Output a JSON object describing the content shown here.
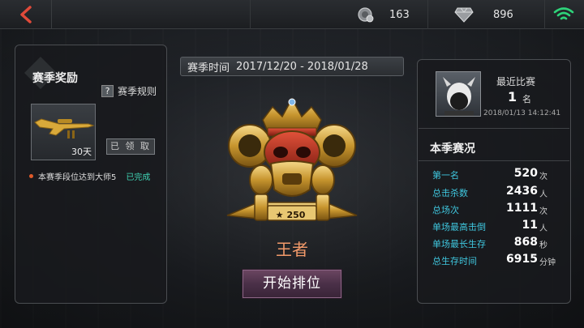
{
  "topbar": {
    "currency1": {
      "icon": "medal-coin-icon",
      "value": "163"
    },
    "currency2": {
      "icon": "diamond-icon",
      "value": "896"
    },
    "wifi_color": "#2ed37a"
  },
  "rewards": {
    "title": "赛季奖励",
    "rules_label": "赛季规则",
    "reward_item": {
      "icon": "gold-sniper-rifle-icon",
      "days": "30天"
    },
    "claim_label": "已 领 取",
    "task": {
      "text": "本赛季段位达到大师5",
      "status": "已完成"
    }
  },
  "season": {
    "label": "赛季时间",
    "range": "2017/12/20 - 2018/01/28"
  },
  "rank": {
    "stars": "250",
    "name": "王者",
    "start_button": "开始排位"
  },
  "recent": {
    "title": "最近比赛",
    "rank": "1",
    "rank_unit": "名",
    "time": "2018/01/13 14:12:41"
  },
  "season_status": {
    "title": "本季赛况",
    "stats": [
      {
        "label": "第一名",
        "value": "520",
        "unit": "次"
      },
      {
        "label": "总击杀数",
        "value": "2436",
        "unit": "人"
      },
      {
        "label": "总场次",
        "value": "1111",
        "unit": "次"
      },
      {
        "label": "单场最高击倒",
        "value": "11",
        "unit": "人"
      },
      {
        "label": "单场最长生存",
        "value": "868",
        "unit": "秒"
      },
      {
        "label": "总生存时间",
        "value": "6915",
        "unit": "分钟"
      }
    ]
  },
  "colors": {
    "accent_cyan": "#3fc6de",
    "complete_green": "#3fd4b4",
    "rank_name": "#f29a6a",
    "back_arrow": "#e04a3a"
  }
}
